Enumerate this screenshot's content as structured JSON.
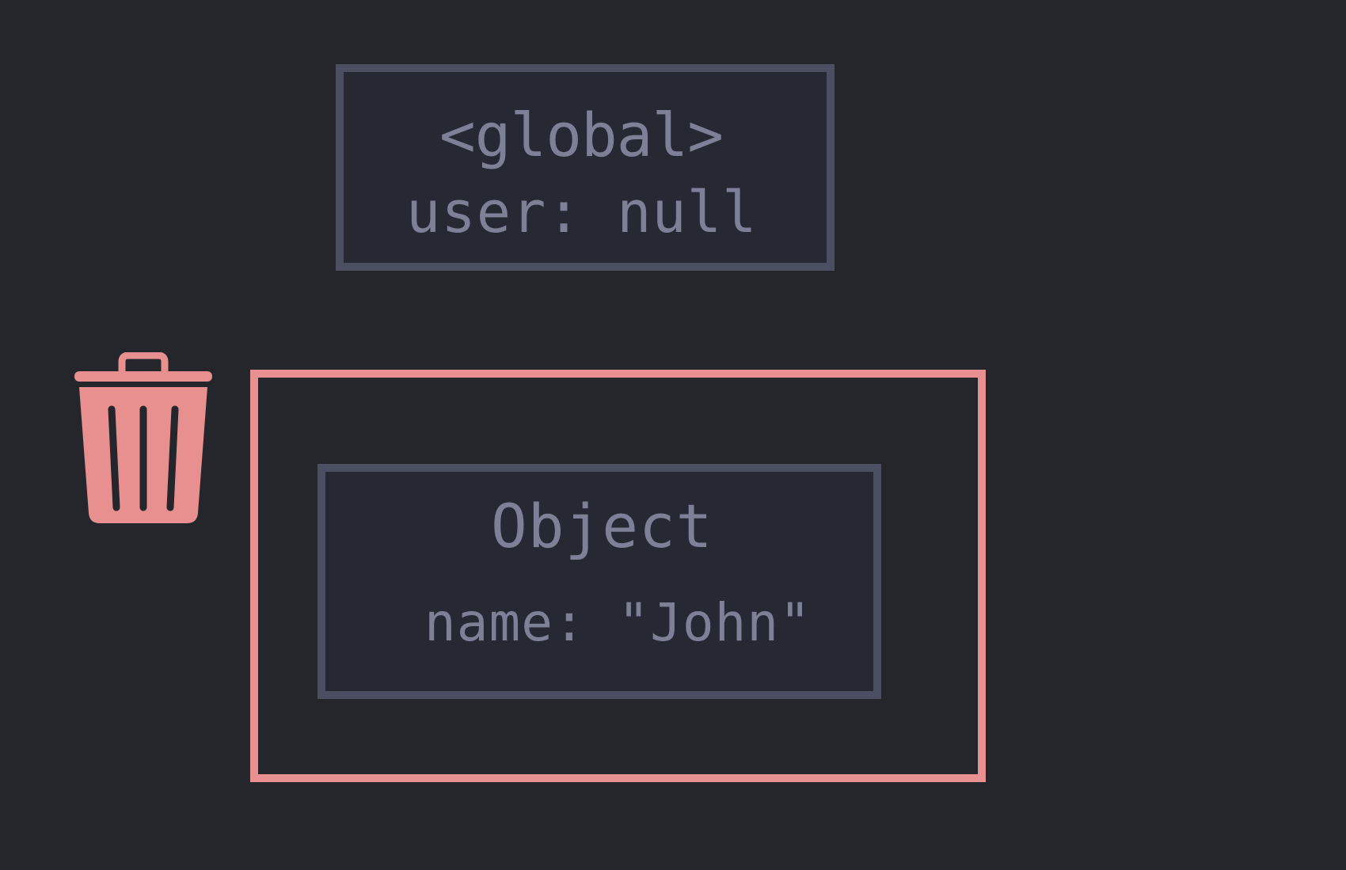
{
  "colors": {
    "background": "#25262b",
    "node_fill": "#262833",
    "node_border": "#4c4e62",
    "node_text": "#7d8096",
    "garbage_accent": "#e88f8f"
  },
  "global_node": {
    "title": "<global>",
    "property": "user: null"
  },
  "object_node": {
    "title": "Object",
    "property": "name: \"John\""
  },
  "icons": {
    "trash": "trash-icon"
  }
}
